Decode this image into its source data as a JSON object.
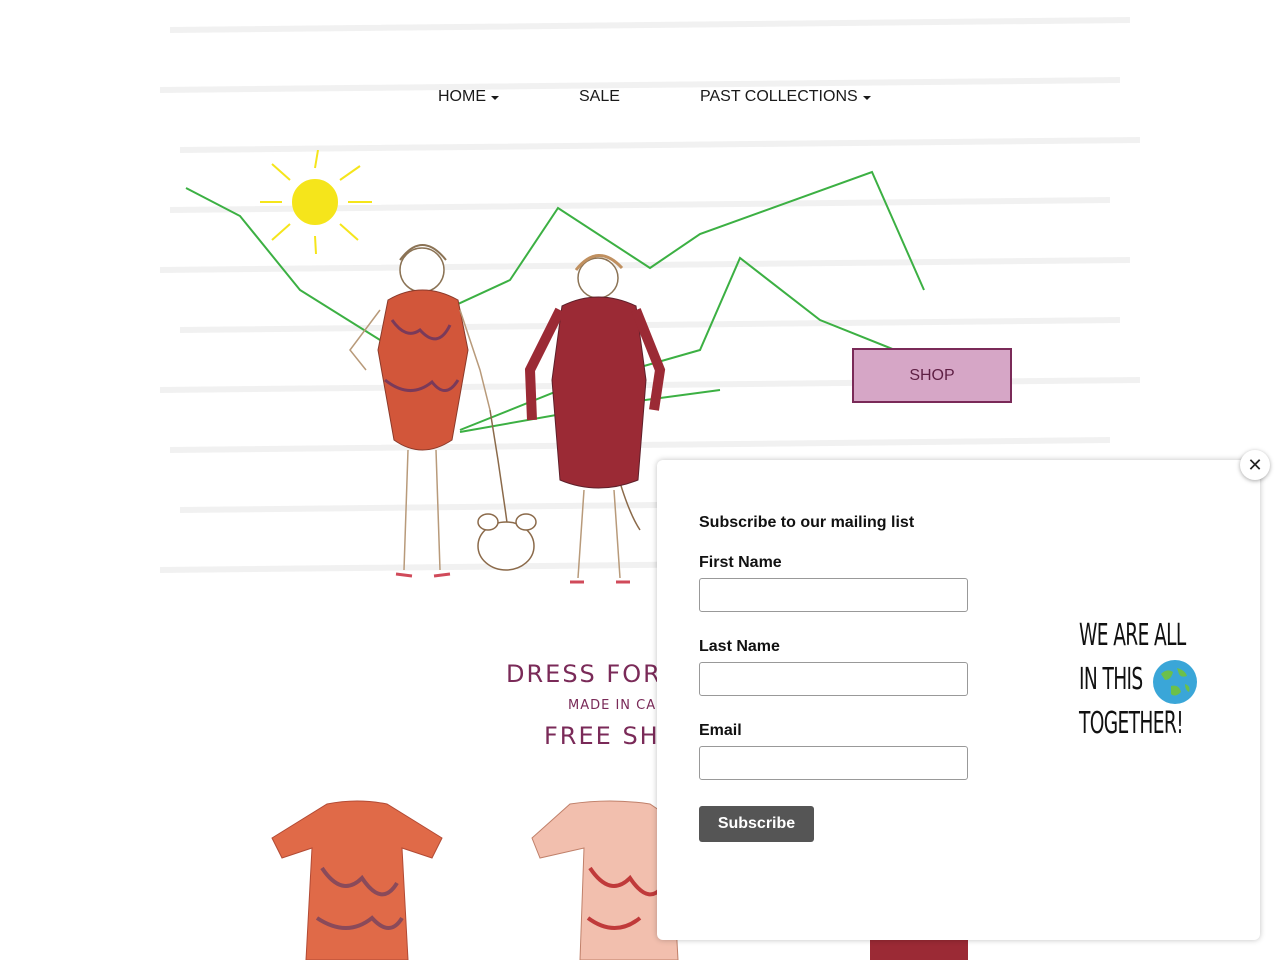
{
  "nav": {
    "home_label": "HOME",
    "sale_label": "SALE",
    "past_collections_label": "PAST COLLECTIONS"
  },
  "hero": {
    "shop_label": "SHOP"
  },
  "taglines": {
    "line1": "DRESS FOR SU",
    "line2": "MADE IN CANA",
    "line3": "FREE SHIPP"
  },
  "popup": {
    "heading": "Subscribe to our mailing list",
    "first_name_label": "First Name",
    "last_name_label": "Last Name",
    "email_label": "Email",
    "subscribe_label": "Subscribe",
    "close_symbol": "✕",
    "together_lines": [
      "WE ARE ALL",
      "IN THIS",
      "TOGETHER!"
    ]
  },
  "colors": {
    "accent": "#7a2a58",
    "shop_fill": "#d6a6c6",
    "mountain": "#3cb043",
    "sun": "#f5e51b"
  },
  "icons": {
    "close": "close-icon",
    "globe": "globe-icon",
    "caret": "caret-down-icon"
  }
}
